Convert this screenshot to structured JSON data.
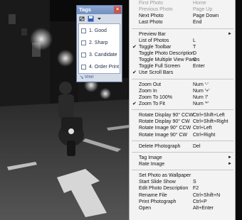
{
  "tags_window": {
    "title": "Tags",
    "close_label": "×",
    "tags": [
      {
        "label": "1. Good",
        "checked": false
      },
      {
        "label": "2. Sharp",
        "checked": false
      },
      {
        "label": "3. Candidate",
        "checked": false
      },
      {
        "label": "4. Order Print",
        "checked": false
      }
    ],
    "footer_label": "Vmrr"
  },
  "context_menu": {
    "groups": [
      [
        {
          "label": "First Photo",
          "shortcut": "Home",
          "disabled": true
        },
        {
          "label": "Previous Photo",
          "shortcut": "Page Up",
          "disabled": true
        },
        {
          "label": "Next Photo",
          "shortcut": "Page Down"
        },
        {
          "label": "Last Photo",
          "shortcut": "End"
        }
      ],
      [
        {
          "label": "Preview Bar",
          "submenu": true
        },
        {
          "label": "List of Photos",
          "shortcut": "L"
        },
        {
          "label": "Toggle Toolbar",
          "shortcut": "T",
          "checked": true
        },
        {
          "label": "Toggle Photo Description",
          "shortcut": "D"
        },
        {
          "label": "Toggle Multiple View Panes",
          "shortcut": "C"
        },
        {
          "label": "Toggle Full Screen",
          "shortcut": "Enter"
        },
        {
          "label": "Use Scroll Bars",
          "checked": true
        }
      ],
      [
        {
          "label": "Zoom Out",
          "shortcut": "Num '-'"
        },
        {
          "label": "Zoom In",
          "shortcut": "Num '+'"
        },
        {
          "label": "Zoom To 100%",
          "shortcut": "Num '/'"
        },
        {
          "label": "Zoom To Fit",
          "shortcut": "Num '*'",
          "checked": true
        }
      ],
      [
        {
          "label": "Rotate Display 90° CCW",
          "shortcut": "Ctrl+Shift+Left"
        },
        {
          "label": "Rotate Display 90° CW",
          "shortcut": "Ctrl+Shift+Right"
        },
        {
          "label": "Rotate Image 90° CCW",
          "shortcut": "Ctrl+Left"
        },
        {
          "label": "Rotate Image 90° CW",
          "shortcut": "Ctrl+Right"
        }
      ],
      [
        {
          "label": "Delete Photograph",
          "shortcut": "Del"
        }
      ],
      [
        {
          "label": "Tag Image",
          "submenu": true
        },
        {
          "label": "Rate Image",
          "submenu": true
        }
      ],
      [
        {
          "label": "Set Photo as Wallpaper"
        },
        {
          "label": "Start Slide Show",
          "shortcut": "S"
        },
        {
          "label": "Edit Photo Description",
          "shortcut": "F2"
        },
        {
          "label": "Rename File",
          "shortcut": "Ctrl+Shift+N"
        },
        {
          "label": "Print Photograph",
          "shortcut": "Ctrl+P"
        },
        {
          "label": "Open",
          "shortcut": "Alt+Enter"
        }
      ]
    ]
  }
}
